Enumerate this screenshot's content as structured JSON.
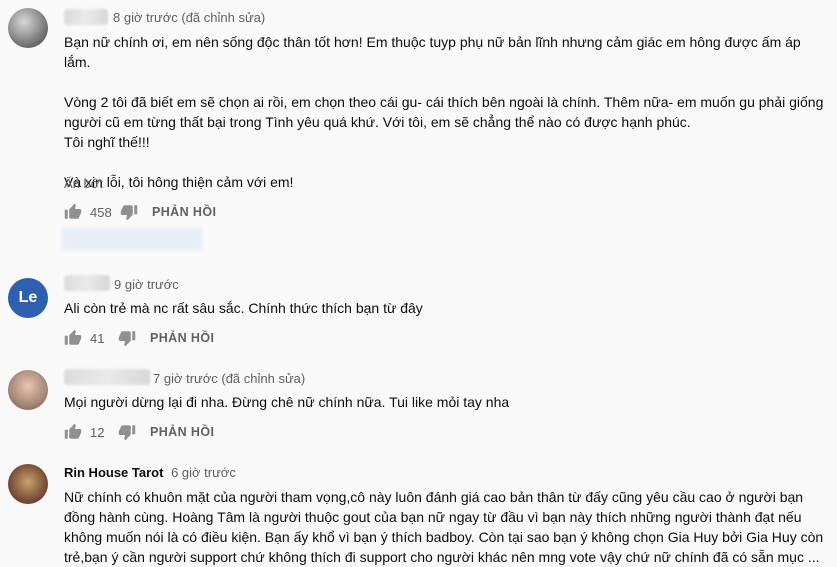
{
  "comments": [
    {
      "time": "8 giờ trước (đã chỉnh sửa)",
      "text": "Bạn nữ chính ơi, em nên sống độc thân tốt hơn! Em thuộc tuyp phụ nữ bản lĩnh nhưng cảm giác em hông được ấm áp lắm.\n\nVòng 2 tôi đã biết em sẽ chọn ai rồi, em chọn theo cái gu- cái thích bên ngoài là chính. Thêm nữa- em muốn gu phải giống\nngười cũ em từng thất bại trong Tình yêu quá khứ. Với tôi, em sẽ chẳng thể nào có được hạnh phúc.\nTôi nghĩ thế!!!\n\nVà xin lỗi, tôi hông thiện cảm với em!",
      "show_less": "Ẩn bớt",
      "likes": "458",
      "reply": "PHẢN HỒI"
    },
    {
      "time": "9 giờ trước",
      "avatar_text": "Le",
      "text": "Ali còn trẻ mà nc rất sâu sắc. Chính thức thích bạn từ đây",
      "likes": "41",
      "reply": "PHẢN HỒI"
    },
    {
      "time": "7 giờ trước (đã chỉnh sửa)",
      "text": "Mọi người dừng lại đi nha. Đừng chê nữ chính nữa. Tui like mỏi tay nha",
      "likes": "12",
      "reply": "PHẢN HỒI"
    },
    {
      "author": "Rin House Tarot",
      "time": "6 giờ trước",
      "text": "Nữ chính có khuôn mặt của người tham vọng,cô này luôn đánh giá cao bản thân từ đấy cũng yêu cầu cao ở người bạn\nđồng hành cùng. Hoàng Tâm là người thuộc gout của bạn nữ ngay từ đầu vì bạn này thích những người thành đạt nếu\nkhông muốn nói là có điều kiện. Bạn ấy khổ vì bạn ý thích badboy. Còn tại sao bạn ý không chọn Gia Huy bởi Gia Huy còn\ntrẻ,bạn ý cần người support chứ không thích đi support cho người khác nên mng vote vậy chứ nữ chính đã có sẵn mục ..."
    }
  ],
  "icons": {
    "like": "thumb-up-icon",
    "dislike": "thumb-down-icon"
  }
}
